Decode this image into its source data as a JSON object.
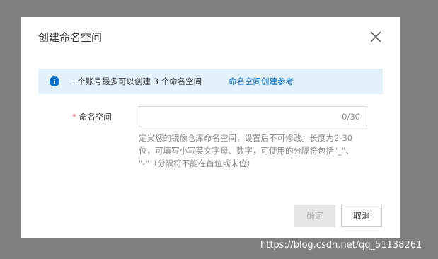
{
  "dialog": {
    "title": "创建命名空间",
    "close_icon": "close-icon"
  },
  "notice": {
    "icon": "info-icon",
    "text": "一个账号最多可以创建 3 个命名空间",
    "link": "命名空间创建参考",
    "background": "#e3f1fd",
    "icon_color": "#0070cc"
  },
  "form": {
    "namespace": {
      "required_mark": "*",
      "label": "命名空间",
      "value": "",
      "placeholder": "",
      "char_count": "0/30",
      "help_lines": [
        "定义您的镜像仓库命名空间，设置后不可修改。长度为2-30",
        "位，可填写小写英文字母、数字，可使用的分隔符包括\"_\"、",
        "\"-\"（分隔符不能在首位或末位）"
      ]
    }
  },
  "footer": {
    "confirm_label": "确定",
    "cancel_label": "取消",
    "confirm_disabled": true
  },
  "watermark": "https://blog.csdn.net/qq_51138261",
  "colors": {
    "link": "#0070cc",
    "required": "#e54545",
    "overlay": "#808080"
  }
}
